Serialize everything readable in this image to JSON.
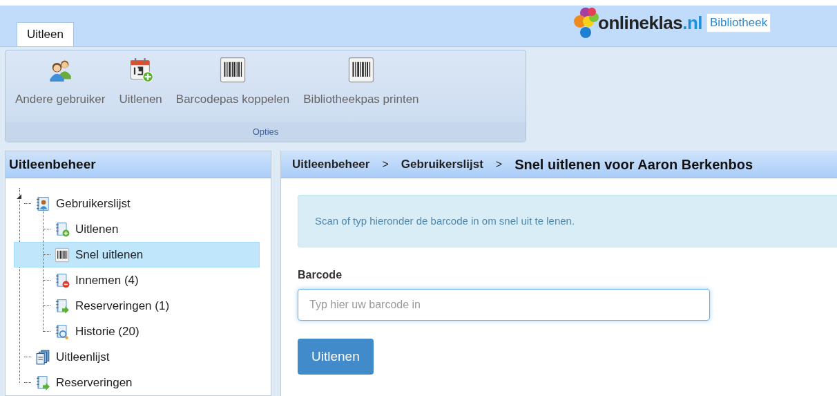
{
  "logo": {
    "name": "onlineklas",
    "suffix": ".nl",
    "tag": "Bibliotheek"
  },
  "tabs": [
    {
      "label": "Uitleen",
      "selected": true
    }
  ],
  "ribbon": {
    "buttons": [
      {
        "label": "Andere gebruiker",
        "kind": "users"
      },
      {
        "label": "Uitlenen",
        "kind": "calendar"
      },
      {
        "label": "Barcodepas koppelen",
        "kind": "barcode"
      },
      {
        "label": "Bibliotheekpas printen",
        "kind": "barcode"
      }
    ],
    "group_label": "Opties"
  },
  "sidebar": {
    "title": "Uitleenbeheer",
    "items": [
      {
        "label": "Gebruikerslijst",
        "kind": "contacts",
        "selected": false,
        "expanded": true,
        "children": [
          {
            "label": "Uitlenen",
            "kind": "add",
            "selected": false
          },
          {
            "label": "Snel uitlenen",
            "kind": "barcode",
            "selected": true
          },
          {
            "label": "Innemen (4)",
            "kind": "remove",
            "selected": false
          },
          {
            "label": "Reserveringen (1)",
            "kind": "forward",
            "selected": false
          },
          {
            "label": "Historie (20)",
            "kind": "search",
            "selected": false
          }
        ]
      },
      {
        "label": "Uitleenlijst",
        "kind": "stack",
        "selected": false
      },
      {
        "label": "Reserveringen",
        "kind": "forward",
        "selected": false
      }
    ]
  },
  "breadcrumb": [
    "Uitleenbeheer",
    "Gebruikerslijst",
    "Snel uitlenen voor Aaron Berkenbos"
  ],
  "breadcrumb_separator": ">",
  "info": "Scan of typ hieronder de barcode in om snel uit te lenen.",
  "form": {
    "label": "Barcode",
    "placeholder": "Typ hier uw barcode in",
    "button": "Uitlenen"
  }
}
